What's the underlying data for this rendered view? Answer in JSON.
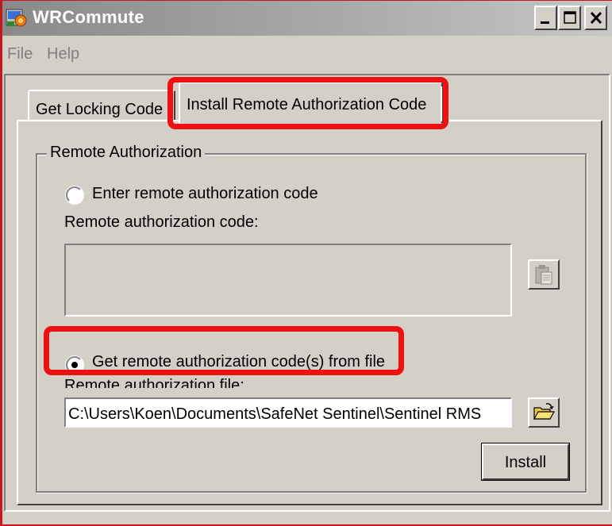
{
  "window": {
    "title": "WRCommute",
    "controls": {
      "minimize": "minimize",
      "maximize": "maximize",
      "close": "close"
    }
  },
  "menu": {
    "file": "File",
    "help": "Help"
  },
  "tabs": {
    "get_locking_code": "Get Locking Code",
    "install_remote": "Install Remote Authorization Code"
  },
  "group": {
    "title": "Remote Authorization",
    "option_enter": "Enter remote authorization code",
    "code_label": "Remote authorization code:",
    "code_value": "",
    "option_file": "Get remote authorization code(s) from file",
    "file_label": "Remote authorization file:",
    "file_value": "C:\\Users\\Koen\\Documents\\SafeNet Sentinel\\Sentinel RMS"
  },
  "buttons": {
    "install": "Install"
  },
  "state": {
    "selected_option": "file"
  },
  "colors": {
    "highlight": "#ee1111",
    "face": "#d4d0c8"
  },
  "icons": {
    "paste": "paste-clipboard-icon",
    "browse": "open-folder-icon",
    "app": "wrcommute-app-icon"
  }
}
